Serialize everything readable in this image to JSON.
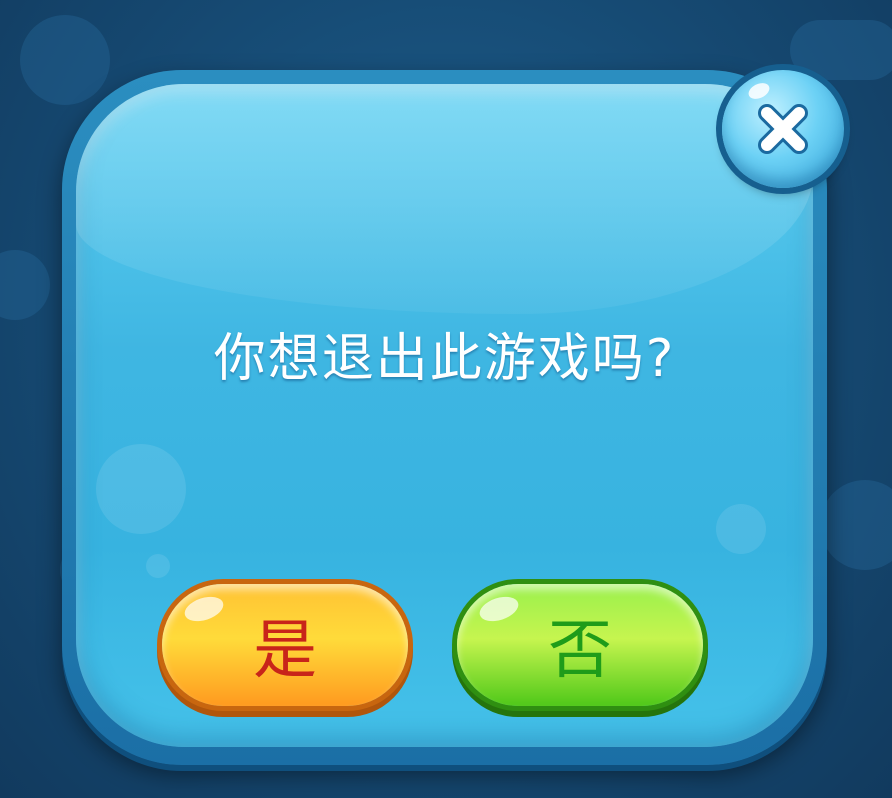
{
  "dialog": {
    "message": "你想退出此游戏吗?"
  },
  "buttons": {
    "yes_label": "是",
    "no_label": "否"
  },
  "close": {
    "icon": "close-icon"
  },
  "colors": {
    "dialog_fill": "#3fb6e2",
    "yes_button": "#ffc233",
    "yes_text": "#c8251a",
    "no_button": "#9af04c",
    "no_text": "#1f9c1a"
  }
}
